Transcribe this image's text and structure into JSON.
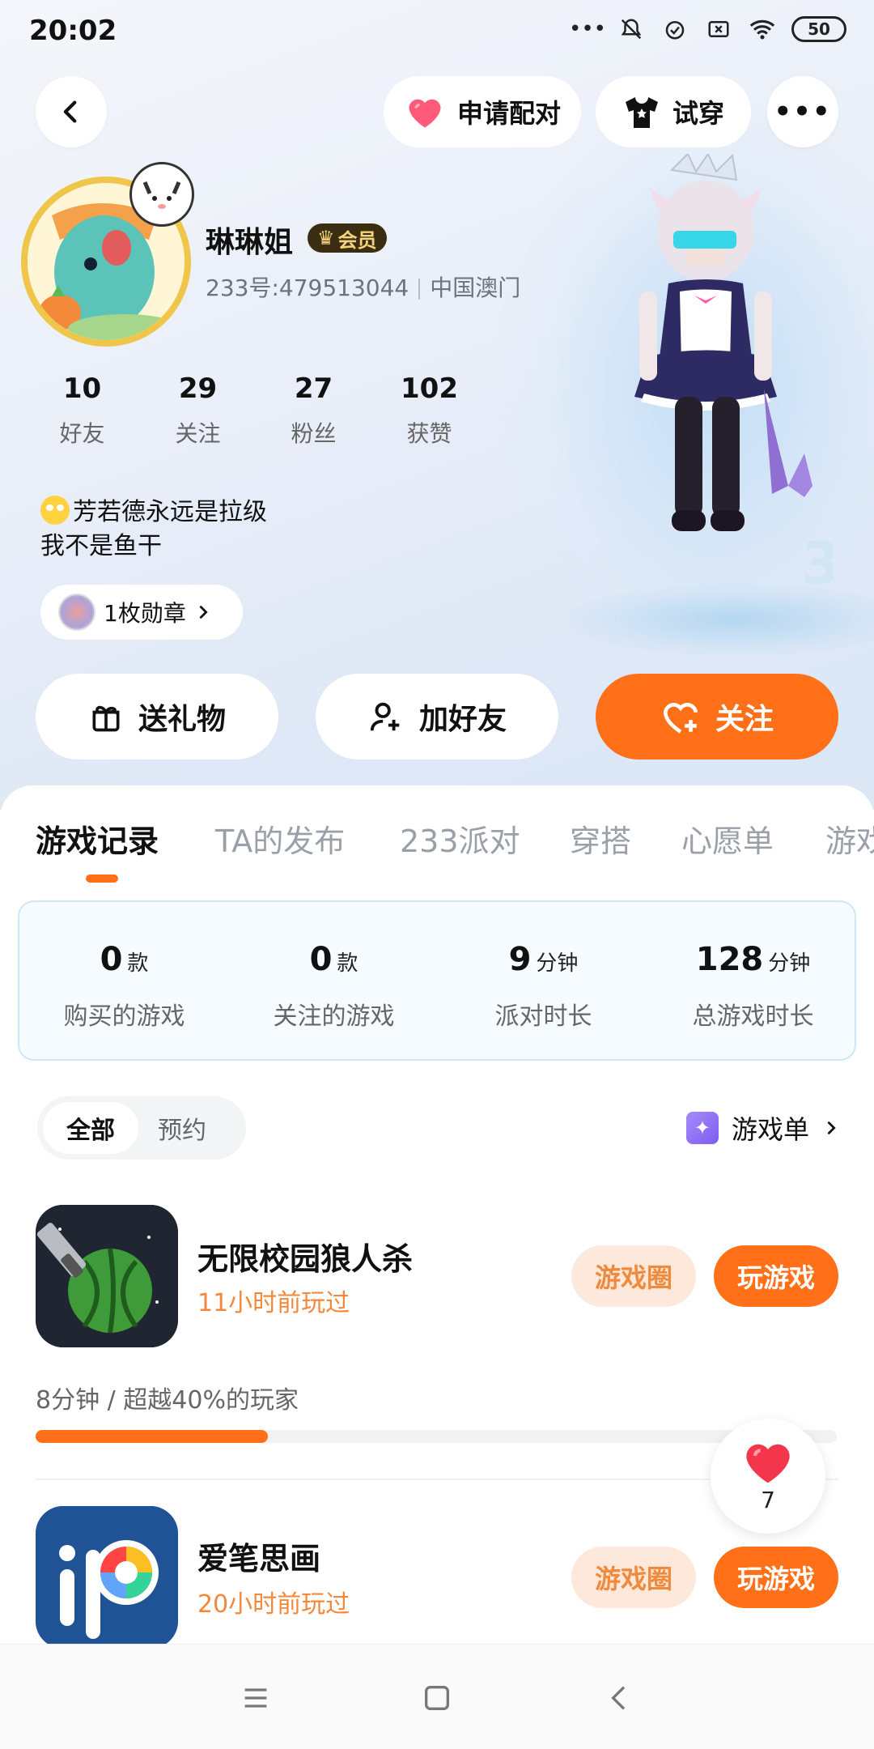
{
  "status_bar": {
    "time": "20:02",
    "battery": "50",
    "icons": [
      "more-dots-icon",
      "bell-muted-icon",
      "alarm-icon",
      "sim-off-icon",
      "wifi-icon",
      "battery-icon"
    ]
  },
  "header": {
    "back_icon": "chevron-left-icon",
    "pair_label": "申请配对",
    "try_on_label": "试穿",
    "more_icon": "more-dots-icon"
  },
  "profile": {
    "username": "琳琳姐",
    "vip_label": "会员",
    "user_id": "233号:479513044",
    "location": "中国澳门",
    "stats": [
      {
        "value": "10",
        "label": "好友"
      },
      {
        "value": "29",
        "label": "关注"
      },
      {
        "value": "27",
        "label": "粉丝"
      },
      {
        "value": "102",
        "label": "获赞"
      }
    ],
    "bio_line1": "芳若德永远是拉级",
    "bio_line2": "我不是鱼干",
    "medal_label": "1枚勋章"
  },
  "actions": {
    "gift_label": "送礼物",
    "add_friend_label": "加好友",
    "follow_label": "关注"
  },
  "tabs": [
    "游戏记录",
    "TA的发布",
    "233派对",
    "穿搭",
    "心愿单",
    "游戏"
  ],
  "game_stats": [
    {
      "value": "0",
      "unit": "款",
      "label": "购买的游戏"
    },
    {
      "value": "0",
      "unit": "款",
      "label": "关注的游戏"
    },
    {
      "value": "9",
      "unit": "分钟",
      "label": "派对时长"
    },
    {
      "value": "128",
      "unit": "分钟",
      "label": "总游戏时长"
    }
  ],
  "filter": {
    "all_label": "全部",
    "reserve_label": "预约",
    "game_list_label": "游戏单"
  },
  "games": [
    {
      "name": "无限校园狼人杀",
      "last_played": "11小时前玩过",
      "circle_label": "游戏圈",
      "play_label": "玩游戏",
      "progress_text": "8分钟 / 超越40%的玩家",
      "progress_fraction": 0.29
    },
    {
      "name": "爱笔思画",
      "last_played": "20小时前玩过",
      "circle_label": "游戏圈",
      "play_label": "玩游戏"
    }
  ],
  "like_float": {
    "count": "7"
  },
  "colors": {
    "accent": "#ff7018",
    "accent_soft": "#fde9dc",
    "accent_text": "#f08a3c",
    "vip_bg": "#3a2d12",
    "vip_fg": "#f6d37a"
  }
}
